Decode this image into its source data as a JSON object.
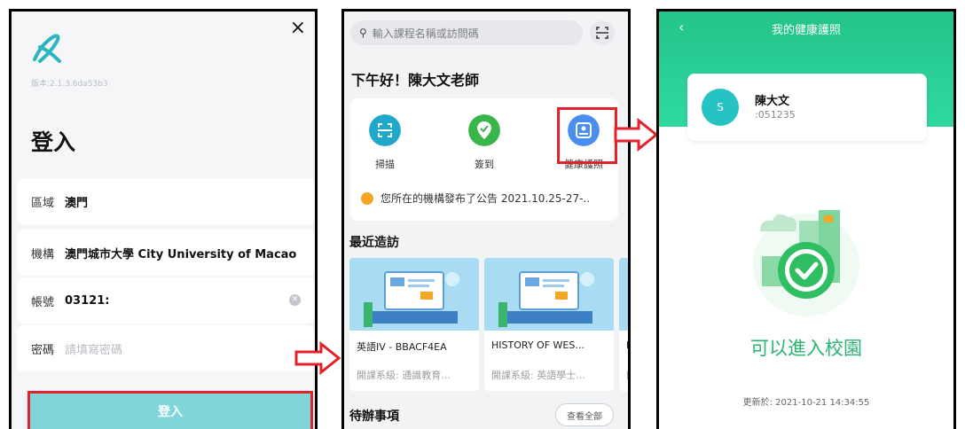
{
  "login": {
    "close_label": "×",
    "version": "版本:2.1.3.6da53b3",
    "title": "登入",
    "region": {
      "label": "區域",
      "value": "澳門"
    },
    "institution": {
      "label": "機構",
      "value": "澳門城市大學 City University of Macao"
    },
    "account": {
      "label": "帳號",
      "value": "03121:"
    },
    "password": {
      "label": "密碼",
      "placeholder": "請填寫密碼"
    },
    "submit_label": "登入"
  },
  "home": {
    "search_placeholder": "輸入課程名稱或訪問碼",
    "greeting": "下午好！陳大文老師",
    "actions": [
      {
        "label": "掃描",
        "icon": "scan-icon",
        "color": "#1fa8c9"
      },
      {
        "label": "簽到",
        "icon": "checkin-icon",
        "color": "#3ab54a"
      },
      {
        "label": "健康護照",
        "icon": "health-passport-icon",
        "color": "#4a8ff0"
      }
    ],
    "notice": "您所在的機構發布了公告 2021.10.25-27-..",
    "recent_title": "最近造訪",
    "courses": [
      {
        "title": "英語IV - BBACF4EA",
        "subtitle": "開課系級: 通識教育..."
      },
      {
        "title": "HISTORY OF WES...",
        "subtitle": "開課系級: 英語學士..."
      },
      {
        "title": "H",
        "subtitle": "開"
      }
    ],
    "todo_title": "待辦事項",
    "see_all": "查看全部"
  },
  "health": {
    "back": "‹",
    "title": "我的健康護照",
    "avatar_letter": "S",
    "name": "陳大文",
    "id": ":051235",
    "status": "可以進入校園",
    "updated": "更新於: 2021-10-21 14:34:55",
    "accent": "#2ab573"
  }
}
